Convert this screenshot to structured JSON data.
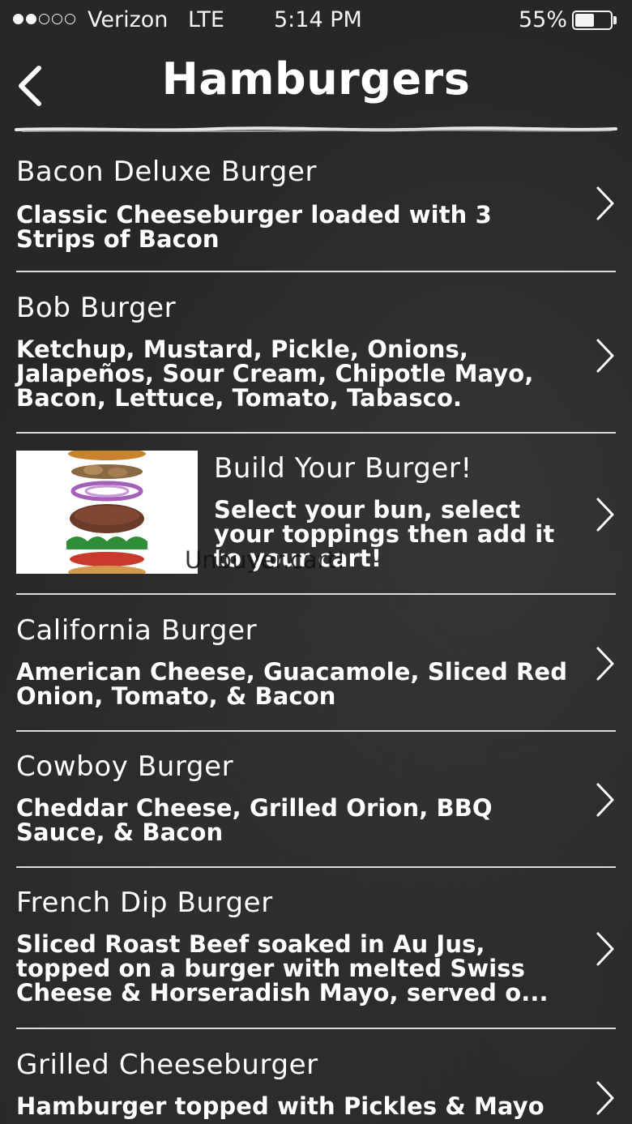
{
  "status_bar": {
    "carrier": "Verizon",
    "network": "LTE",
    "time": "5:14 PM",
    "battery_percent": "55%",
    "battery_level": 0.55,
    "signal_filled": 2,
    "signal_total": 5
  },
  "nav": {
    "title": "Hamburgers",
    "back_icon": "chevron-left-icon"
  },
  "items": [
    {
      "name": "Bacon Deluxe Burger",
      "description": "Classic Cheeseburger loaded with 3 Strips of Bacon"
    },
    {
      "name": "Bob Burger",
      "description": "Ketchup, Mustard, Pickle, Onions, Jalapeños, Sour Cream, Chipotle Mayo, Bacon, Lettuce, Tomato, Tabasco."
    },
    {
      "name": "Build Your Burger!",
      "description": "Select your bun, select your toppings then add it to your cart!",
      "overlap_text": "Unbuyer.cart!",
      "image": "burger-stack-image"
    },
    {
      "name": "California Burger",
      "description": "American Cheese, Guacamole, Sliced Red Onion, Tomato, & Bacon"
    },
    {
      "name": "Cowboy Burger",
      "description": "Cheddar Cheese, Grilled Orion, BBQ Sauce, & Bacon"
    },
    {
      "name": "French Dip Burger",
      "description": "Sliced Roast Beef soaked in Au Jus, topped on a burger with melted Swiss Cheese & Horseradish Mayo, served o..."
    },
    {
      "name": "Grilled Cheeseburger",
      "description": "Hamburger topped with Pickles & Mayo"
    }
  ],
  "colors": {
    "background": "#272727",
    "text": "#ffffff",
    "divider": "#dcdcdc"
  }
}
